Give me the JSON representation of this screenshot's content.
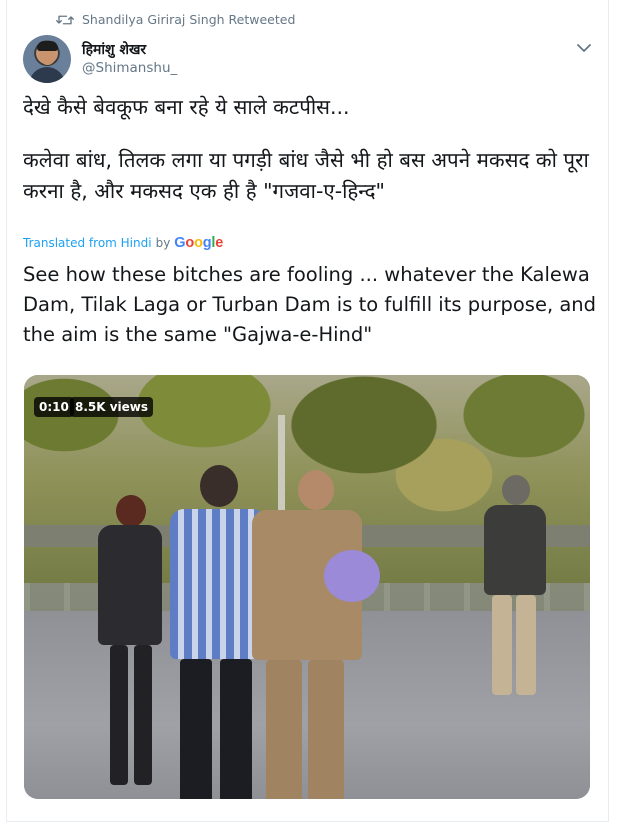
{
  "retweet": {
    "text": "Shandilya Giriraj Singh Retweeted",
    "icon": "retweet-icon"
  },
  "author": {
    "display_name": "हिमांशु शेखर",
    "handle": "@Shimanshu_",
    "avatar": "avatar"
  },
  "menu": {
    "icon": "chevron-down-icon"
  },
  "tweet": {
    "line1": "देखे कैसे बेवकूफ बना रहे ये साले कटपीस...",
    "line2": "कलेवा बांध, तिलक लगा या पगड़ी बांध जैसे भी हो बस अपने मकसद को पूरा करना है, और मकसद एक ही है \"गजवा-ए-हिन्द\""
  },
  "translation": {
    "label": "Translated from Hindi",
    "by": "by",
    "provider": "Google",
    "text": "See how these bitches are fooling ... whatever the Kalewa Dam, Tilak Laga or Turban Dam is to fulfill its purpose, and the aim is the same \"Gajwa-e-Hind\""
  },
  "video": {
    "duration": "0:10",
    "views": "8.5K views"
  },
  "colors": {
    "link": "#1da1f2",
    "secondary_text": "#657786",
    "primary_text": "#14171a",
    "google_blue": "#4285f4",
    "google_red": "#ea4335",
    "google_yellow": "#fbbc05",
    "google_green": "#34a853"
  }
}
